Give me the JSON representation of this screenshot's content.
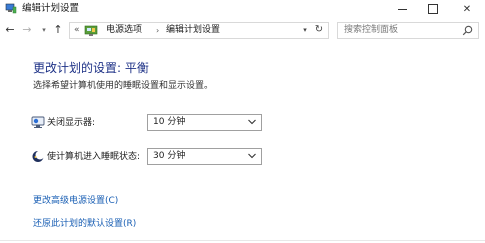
{
  "window": {
    "title": "编辑计划设置",
    "controls": {
      "minimize": "minimize-icon",
      "maximize": "maximize-icon",
      "close": "close-icon",
      "close_glyph": "✕"
    }
  },
  "nav": {
    "back_glyph": "←",
    "forward_glyph": "→",
    "recent_glyph": "▾",
    "up_glyph": "↑",
    "refresh_glyph": "↻",
    "address": {
      "prefix": "«",
      "crumbs": [
        "电源选项",
        "编辑计划设置"
      ],
      "separator": "›",
      "dropdown_glyph": "▾"
    },
    "search": {
      "placeholder": "搜索控制面板"
    }
  },
  "main": {
    "heading": "更改计划的设置: 平衡",
    "subtext": "选择希望计算机使用的睡眠设置和显示设置。",
    "settings": [
      {
        "label": "关闭显示器:",
        "value": "10 分钟",
        "icon": "monitor-icon"
      },
      {
        "label": "使计算机进入睡眠状态:",
        "value": "30 分钟",
        "icon": "moon-icon"
      }
    ],
    "links": [
      "更改高级电源设置(C)",
      "还原此计划的默认设置(R)"
    ]
  },
  "colors": {
    "heading": "#1e3287",
    "link": "#1a5fb4"
  }
}
